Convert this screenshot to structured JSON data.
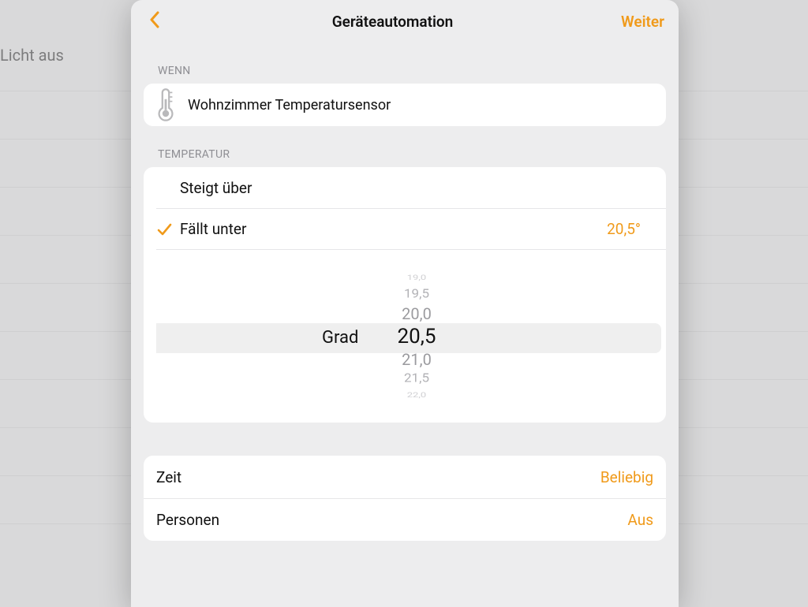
{
  "background": {
    "sidebar_text": "Licht aus"
  },
  "sheet": {
    "title": "Geräteautomation",
    "next_label": "Weiter"
  },
  "wenn": {
    "section_label": "WENN",
    "sensor_name": "Wohnzimmer Temperatursensor"
  },
  "temperatur": {
    "section_label": "TEMPERATUR",
    "options": {
      "rises_above": "Steigt über",
      "falls_below": "Fällt unter",
      "selected_value": "20,5°"
    },
    "picker": {
      "unit_label": "Grad",
      "values": [
        "19,0",
        "19,5",
        "20,0",
        "20,5",
        "21,0",
        "21,5",
        "22,0"
      ]
    }
  },
  "extras": {
    "time_label": "Zeit",
    "time_value": "Beliebig",
    "persons_label": "Personen",
    "persons_value": "Aus"
  },
  "colors": {
    "accent": "#f09a1a"
  }
}
